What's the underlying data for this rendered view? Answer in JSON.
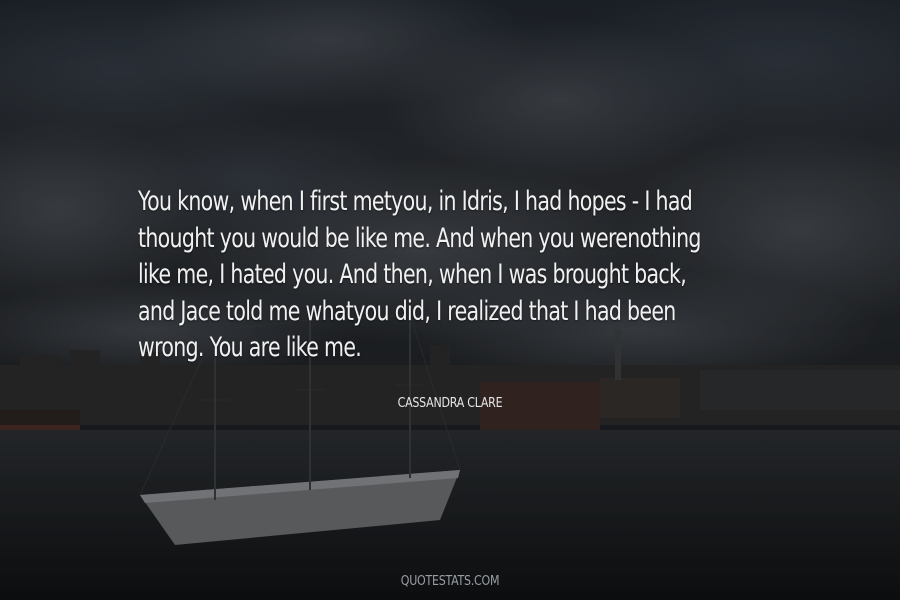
{
  "quote": {
    "lines": [
      "You know, when I first metyou, in Idris, I had hopes - I had",
      "thought you would be like me. And when you werenothing",
      "like me, I hated you. And then, when I was brought back,",
      "and Jace told me whatyou did, I realized that I had been",
      "wrong. You are like me."
    ],
    "author": "CASSANDRA CLARE"
  },
  "footer": {
    "site": "QUOTESTATS.COM"
  },
  "colors": {
    "text": "#f1f1f1",
    "sky": "#2a2d31",
    "water": "#121416"
  }
}
